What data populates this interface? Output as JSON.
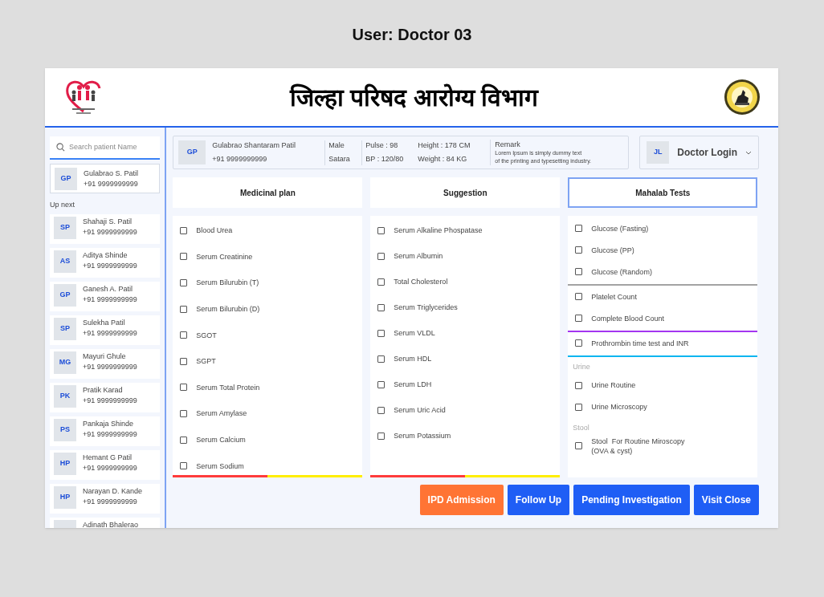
{
  "page_heading": "User: Doctor 03",
  "header": {
    "title": "जिल्हा परिषद आरोग्य विभाग"
  },
  "sidebar": {
    "search": {
      "placeholder": "Search patient Name"
    },
    "current_patient": {
      "initials": "GP",
      "name": "Gulabrao S. Patil",
      "phone": "+91 9999999999"
    },
    "up_next_label": "Up next",
    "queue": [
      {
        "initials": "SP",
        "name": "Shahaji S. Patil",
        "phone": "+91 9999999999"
      },
      {
        "initials": "AS",
        "name": "Aditya Shinde",
        "phone": "+91 9999999999"
      },
      {
        "initials": "GP",
        "name": "Ganesh A. Patil",
        "phone": "+91 9999999999"
      },
      {
        "initials": "SP",
        "name": "Sulekha Patil",
        "phone": "+91 9999999999"
      },
      {
        "initials": "MG",
        "name": "Mayuri Ghule",
        "phone": "+91 9999999999"
      },
      {
        "initials": "PK",
        "name": "Pratik Karad",
        "phone": "+91 9999999999"
      },
      {
        "initials": "PS",
        "name": "Pankaja Shinde",
        "phone": "+91 9999999999"
      },
      {
        "initials": "HP",
        "name": "Hemant G Patil",
        "phone": "+91 9999999999"
      },
      {
        "initials": "HP",
        "name": "Narayan D. Kande",
        "phone": "+91 9999999999"
      },
      {
        "name": "Adinath Bhalerao"
      }
    ]
  },
  "patient_bar": {
    "initials": "GP",
    "name": "Gulabrao Shantaram Patil",
    "phone": "+91 9999999999",
    "sex": "Male",
    "city": "Satara",
    "pulse": "Pulse : 98",
    "bp": "BP : 120/80",
    "height": "Height : 178 CM",
    "weight": "Weight : 84 KG",
    "remark_title": "Remark",
    "remark_lines": [
      "Lorem Ipsum is simply dummy text",
      "of the printing and typesetting industry."
    ]
  },
  "doctor_menu": {
    "initials": "JL",
    "label": "Doctor Login"
  },
  "columns": [
    {
      "title": "Medicinal plan",
      "selected": false,
      "underline": true,
      "groups": [
        {
          "items": [
            {
              "label": "Blood Urea",
              "checked": false
            },
            {
              "label": "Serum Creatinine",
              "checked": false
            },
            {
              "label": "Serum Bilurubin (T)",
              "checked": false
            },
            {
              "label": "Serum Bilurubin (D)",
              "checked": false
            },
            {
              "label": "SGOT",
              "checked": false
            },
            {
              "label": "SGPT",
              "checked": false
            },
            {
              "label": "Serum Total Protein",
              "checked": false
            },
            {
              "label": "Serum Amylase",
              "checked": false
            },
            {
              "label": "Serum Calcium",
              "checked": false
            },
            {
              "label": "Serum Sodium",
              "checked": false
            }
          ]
        }
      ]
    },
    {
      "title": "Suggestion",
      "selected": false,
      "underline": true,
      "groups": [
        {
          "items": [
            {
              "label": "Serum Alkaline Phospatase",
              "checked": false
            },
            {
              "label": "Serum Albumin",
              "checked": false
            },
            {
              "label": "Total Cholesterol",
              "checked": false
            },
            {
              "label": "Serum Triglycerides",
              "checked": false
            },
            {
              "label": "Serum VLDL",
              "checked": false
            },
            {
              "label": "Serum HDL",
              "checked": false
            },
            {
              "label": "Serum LDH",
              "checked": false
            },
            {
              "label": "Serum Uric Acid",
              "checked": false
            },
            {
              "label": "Serum Potassium",
              "checked": false
            }
          ]
        }
      ]
    },
    {
      "title": "Mahalab Tests",
      "selected": true,
      "underline": false,
      "groups": [
        {
          "color": "#a3a3a3",
          "items": [
            {
              "label": "Glucose (Fasting)",
              "checked": false
            },
            {
              "label": "Glucose (PP)",
              "checked": false
            },
            {
              "label": "Glucose (Random)",
              "checked": false
            }
          ]
        },
        {
          "color": "#a435f0",
          "items": [
            {
              "label": "Platelet Count",
              "checked": false
            },
            {
              "label": "Complete Blood Count",
              "checked": false
            }
          ]
        },
        {
          "color": "#0ab6f0",
          "items": [
            {
              "label": "Prothrombin time test and INR",
              "checked": false
            }
          ]
        },
        {
          "label": "Urine",
          "items": [
            {
              "label": "Urine Routine",
              "checked": false
            },
            {
              "label": "Urine Microscopy",
              "checked": false
            }
          ]
        },
        {
          "label": "Stool",
          "items": [
            {
              "label": "Stool  For Routine Miroscopy\n(OVA & cyst)",
              "checked": false
            }
          ]
        }
      ]
    }
  ],
  "buttons": [
    {
      "label": "IPD Admission",
      "kind": "warning"
    },
    {
      "label": "Follow Up",
      "kind": "primary"
    },
    {
      "label": "Pending Investigation",
      "kind": "primary"
    },
    {
      "label": "Visit Close",
      "kind": "primary"
    }
  ]
}
